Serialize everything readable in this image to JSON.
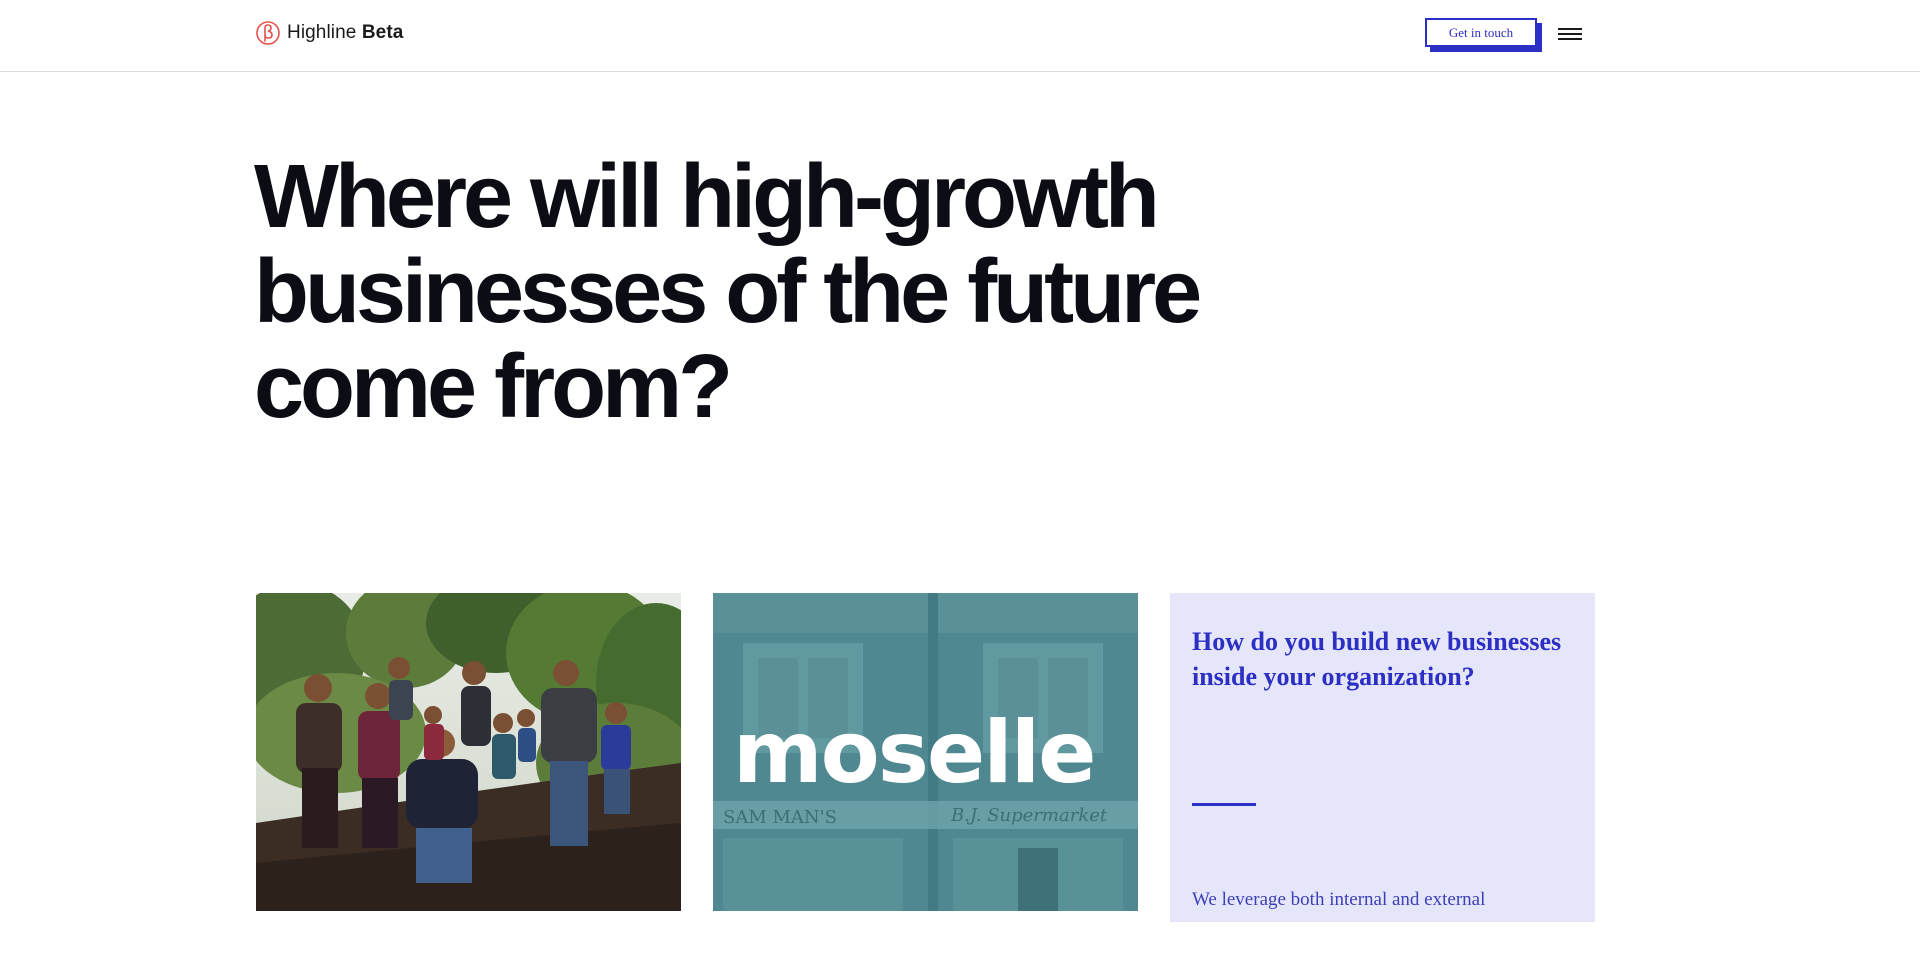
{
  "header": {
    "logo_text_light": "Highline",
    "logo_text_bold": "Beta",
    "cta_label": "Get in touch",
    "menu_icon": "hamburger-menu-icon"
  },
  "hero": {
    "title": "Where will high-growth businesses of the future come from?"
  },
  "cards": {
    "photo_alt": "Group of adults and children standing in a field",
    "moselle_wordmark": "moselle",
    "question": "How do you build new businesses inside your organization?",
    "body_snippet": "We leverage both internal and external"
  },
  "colors": {
    "accent": "#2b2fc4",
    "card_tint": "#e6e6fb",
    "moselle_bg": "#4f8891",
    "logo_mark": "#e4514a",
    "heading": "#0b0c14"
  }
}
